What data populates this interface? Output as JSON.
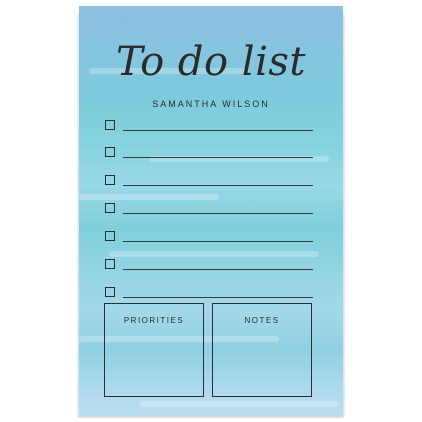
{
  "note_pad": {
    "title": "To do list",
    "name": "SAMANTHA WILSON",
    "checklist_count": 7,
    "sections": {
      "left_label": "PRIORITIES",
      "right_label": "NOTES"
    }
  }
}
